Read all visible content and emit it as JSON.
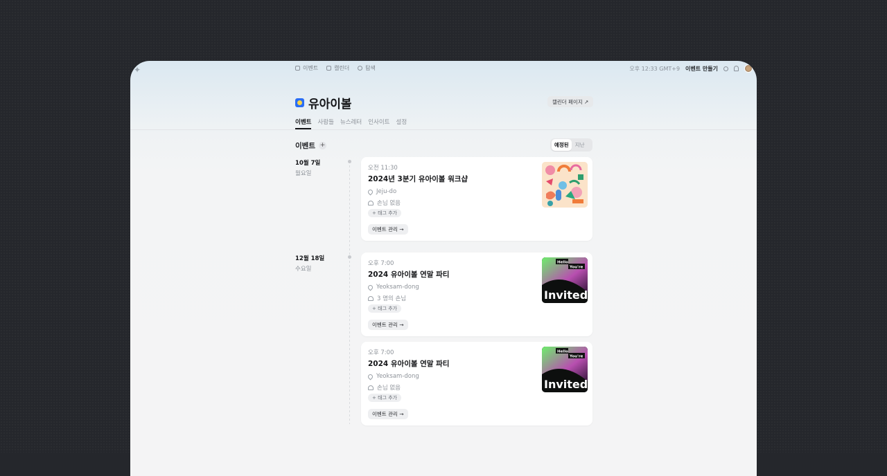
{
  "topbar": {
    "nav": [
      {
        "label": "이벤트",
        "icon": "ticket-icon"
      },
      {
        "label": "캘린더",
        "icon": "calendar-icon"
      },
      {
        "label": "탐색",
        "icon": "compass-icon"
      }
    ],
    "time": "오후 12:33 GMT+9",
    "create_label": "이벤트 만들기"
  },
  "calendar": {
    "title": "유아이볼",
    "page_button": "캘린더 페이지 ↗"
  },
  "tabs": [
    {
      "label": "이벤트",
      "active": true
    },
    {
      "label": "사람들"
    },
    {
      "label": "뉴스레터"
    },
    {
      "label": "인사이트"
    },
    {
      "label": "설정"
    }
  ],
  "events_section": {
    "title": "이벤트",
    "add": "+",
    "toggle": {
      "upcoming": "예정된",
      "past": "지난"
    }
  },
  "groups": [
    {
      "date": "10월 7일",
      "weekday": "월요일"
    },
    {
      "date": "12월 18일",
      "weekday": "수요일"
    }
  ],
  "events": [
    {
      "time": "오전 11:30",
      "title": "2024년 3분기 유아이볼 워크샵",
      "location": "Jeju-do",
      "guests": "손님 없음",
      "tag": "+ 태그 추가",
      "manage": "이벤트 관리 →",
      "thumbnail": "abstract-art"
    },
    {
      "time": "오후 7:00",
      "title": "2024 유아이볼 연말 파티",
      "location": "Yeoksam-dong",
      "guests": "3 명의 손님",
      "tag": "+ 태그 추가",
      "manage": "이벤트 관리 →",
      "thumbnail": "invited"
    },
    {
      "time": "오후 7:00",
      "title": "2024 유아이볼 연말 파티",
      "location": "Yeoksam-dong",
      "guests": "손님 없음",
      "tag": "+ 태그 추가",
      "manage": "이벤트 관리 →",
      "thumbnail": "invited"
    }
  ],
  "invite_art": {
    "hello": "Hello",
    "youre": "You're",
    "invited": "Invited"
  },
  "colors": {
    "background": "#25272c",
    "accent": "#2a6df4",
    "card": "#ffffff"
  }
}
